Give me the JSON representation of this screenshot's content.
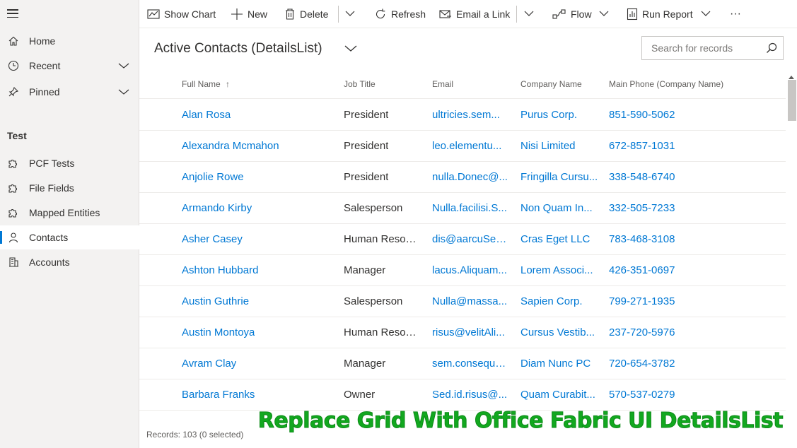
{
  "sidebar": {
    "items": [
      {
        "label": "Home",
        "icon": "home-icon"
      },
      {
        "label": "Recent",
        "icon": "clock-icon"
      },
      {
        "label": "Pinned",
        "icon": "pin-icon"
      }
    ],
    "group_title": "Test",
    "group_items": [
      {
        "label": "PCF Tests",
        "icon": "puzzle-icon"
      },
      {
        "label": "File Fields",
        "icon": "puzzle-icon"
      },
      {
        "label": "Mapped Entities",
        "icon": "puzzle-icon"
      },
      {
        "label": "Contacts",
        "icon": "person-icon",
        "selected": true
      },
      {
        "label": "Accounts",
        "icon": "building-icon"
      }
    ]
  },
  "toolbar": {
    "show_chart": "Show Chart",
    "new": "New",
    "delete": "Delete",
    "refresh": "Refresh",
    "email_link": "Email a Link",
    "flow": "Flow",
    "run_report": "Run Report",
    "more": "···"
  },
  "view": {
    "title": "Active Contacts (DetailsList)"
  },
  "search": {
    "placeholder": "Search for records"
  },
  "grid": {
    "columns": [
      "Full Name",
      "Job Title",
      "Email",
      "Company Name",
      "Main Phone (Company Name)"
    ],
    "sort_indicator": "↑",
    "rows": [
      [
        "Alan Rosa",
        "President",
        "ultricies.sem...",
        "Purus Corp.",
        "851-590-5062"
      ],
      [
        "Alexandra Mcmahon",
        "President",
        "leo.elementu...",
        "Nisi Limited",
        "672-857-1031"
      ],
      [
        "Anjolie Rowe",
        "President",
        "nulla.Donec@...",
        "Fringilla Cursu...",
        "338-548-6740"
      ],
      [
        "Armando Kirby",
        "Salesperson",
        "Nulla.facilisi.S...",
        "Non Quam In...",
        "332-505-7233"
      ],
      [
        "Asher Casey",
        "Human Resou...",
        "dis@aarcuSed...",
        "Cras Eget LLC",
        "783-468-3108"
      ],
      [
        "Ashton Hubbard",
        "Manager",
        "lacus.Aliquam...",
        "Lorem Associ...",
        "426-351-0697"
      ],
      [
        "Austin Guthrie",
        "Salesperson",
        "Nulla@massa...",
        "Sapien Corp.",
        "799-271-1935"
      ],
      [
        "Austin Montoya",
        "Human Resou...",
        "risus@velitAli...",
        "Cursus Vestib...",
        "237-720-5976"
      ],
      [
        "Avram Clay",
        "Manager",
        "sem.consequa...",
        "Diam Nunc PC",
        "720-654-3782"
      ],
      [
        "Barbara Franks",
        "Owner",
        "Sed.id.risus@...",
        "Quam Curabit...",
        "570-537-0279"
      ]
    ]
  },
  "footer": {
    "records": "Records: 103 (0 selected)"
  },
  "overlay": {
    "caption": "Replace Grid With Office Fabric UI DetailsList"
  },
  "colors": {
    "accent": "#0078d4",
    "overlay_green": "#12a81f"
  }
}
